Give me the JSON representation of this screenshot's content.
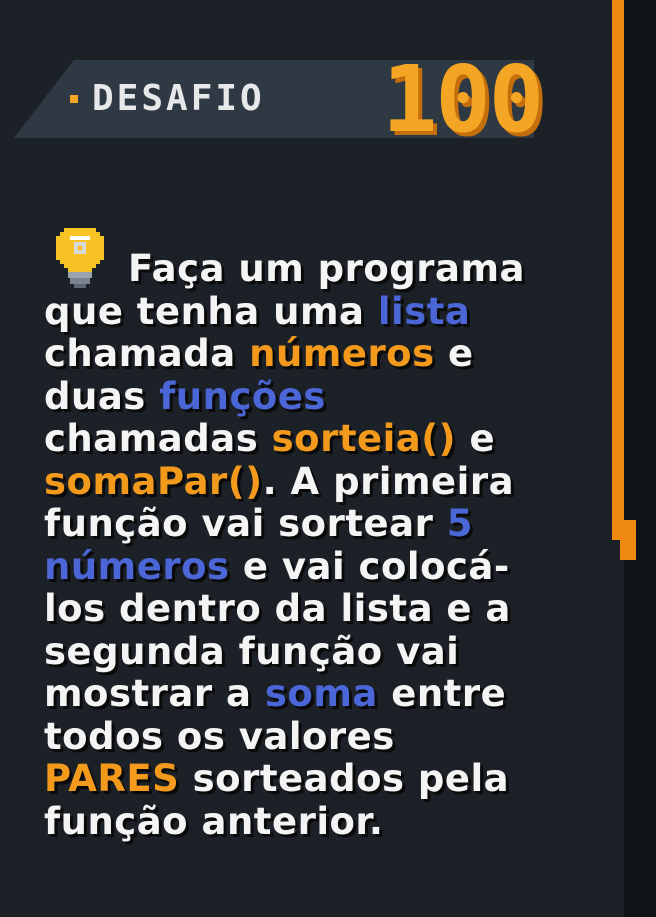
{
  "header": {
    "label": "DESAFIO",
    "number": "100"
  },
  "description": {
    "line1": "Faça um programa",
    "line2_a": "que tenha uma ",
    "line2_b": "lista",
    "line3_a": "chamada ",
    "line3_b": "números",
    "line3_c": " e",
    "line4_a": "duas ",
    "line4_b": "funções",
    "line5_a": "chamadas ",
    "line5_b": "sorteia()",
    "line5_c": " e",
    "line6_a": "somaPar()",
    "line6_b": ". A primeira",
    "line7_a": "função vai sortear ",
    "line7_b": "5",
    "line8_a": "números",
    "line8_b": " e vai colocá-",
    "line9": "los dentro da lista e a",
    "line10": "segunda função vai",
    "line11_a": "mostrar a ",
    "line11_b": "soma",
    "line11_c": " entre",
    "line12": "todos os valores",
    "line13_a": "PARES",
    "line13_b": " sorteados pela",
    "line14": "função anterior."
  },
  "colors": {
    "background": "#1c2128",
    "accent_orange": "#f39a1c",
    "accent_blue": "#4b66d6",
    "text": "#f4f4f4"
  },
  "icons": {
    "idea": "lightbulb-icon"
  }
}
